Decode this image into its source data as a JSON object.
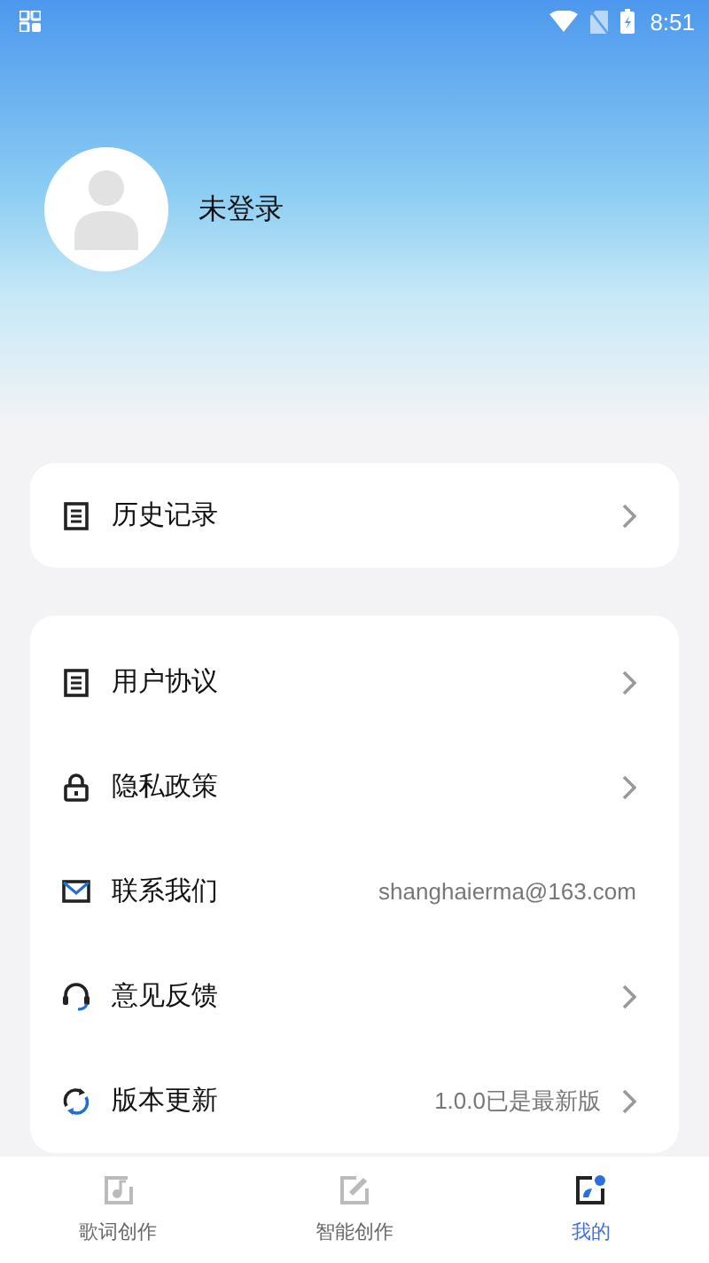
{
  "status_bar": {
    "time": "8:51"
  },
  "profile": {
    "name": "未登录"
  },
  "history_card": {
    "items": [
      {
        "kind": "link",
        "label": "历史记录"
      }
    ]
  },
  "settings_card": {
    "items": [
      {
        "kind": "link",
        "label": "用户协议"
      },
      {
        "kind": "link",
        "label": "隐私政策"
      },
      {
        "kind": "info",
        "label": "联系我们",
        "value": "shanghaierma@163.com"
      },
      {
        "kind": "link",
        "label": "意见反馈"
      },
      {
        "kind": "link",
        "label": "版本更新",
        "value": "1.0.0已是最新版"
      }
    ]
  },
  "tab_bar": {
    "tabs": [
      {
        "label": "歌词创作",
        "selected": false
      },
      {
        "label": "智能创作",
        "selected": false
      },
      {
        "label": "我的",
        "selected": true
      }
    ]
  }
}
